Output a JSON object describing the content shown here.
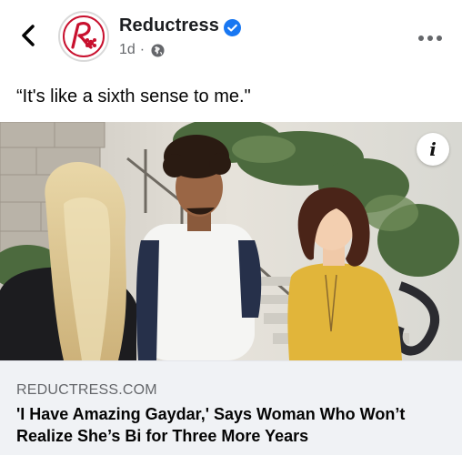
{
  "header": {
    "page_name": "Reductress",
    "timestamp": "1d",
    "separator": "·",
    "privacy_icon": "globe-icon",
    "verified_icon": "verified-badge-icon",
    "back_icon": "chevron-left-icon",
    "more_icon": "more-horizontal-icon"
  },
  "post": {
    "caption": "“It's like a sixth sense to me.\""
  },
  "link_preview": {
    "image_alt": "Four young people talking outdoors near stone steps",
    "info_label": "i",
    "domain": "REDUCTRESS.COM",
    "headline": "'I Have Amazing Gaydar,' Says Woman Who Won’t Realize She’s Bi for Three More Years"
  },
  "colors": {
    "verified_blue": "#1877f2",
    "brand_red": "#c8102e",
    "footer_bg": "#f0f2f5",
    "muted_text": "#65676b"
  }
}
